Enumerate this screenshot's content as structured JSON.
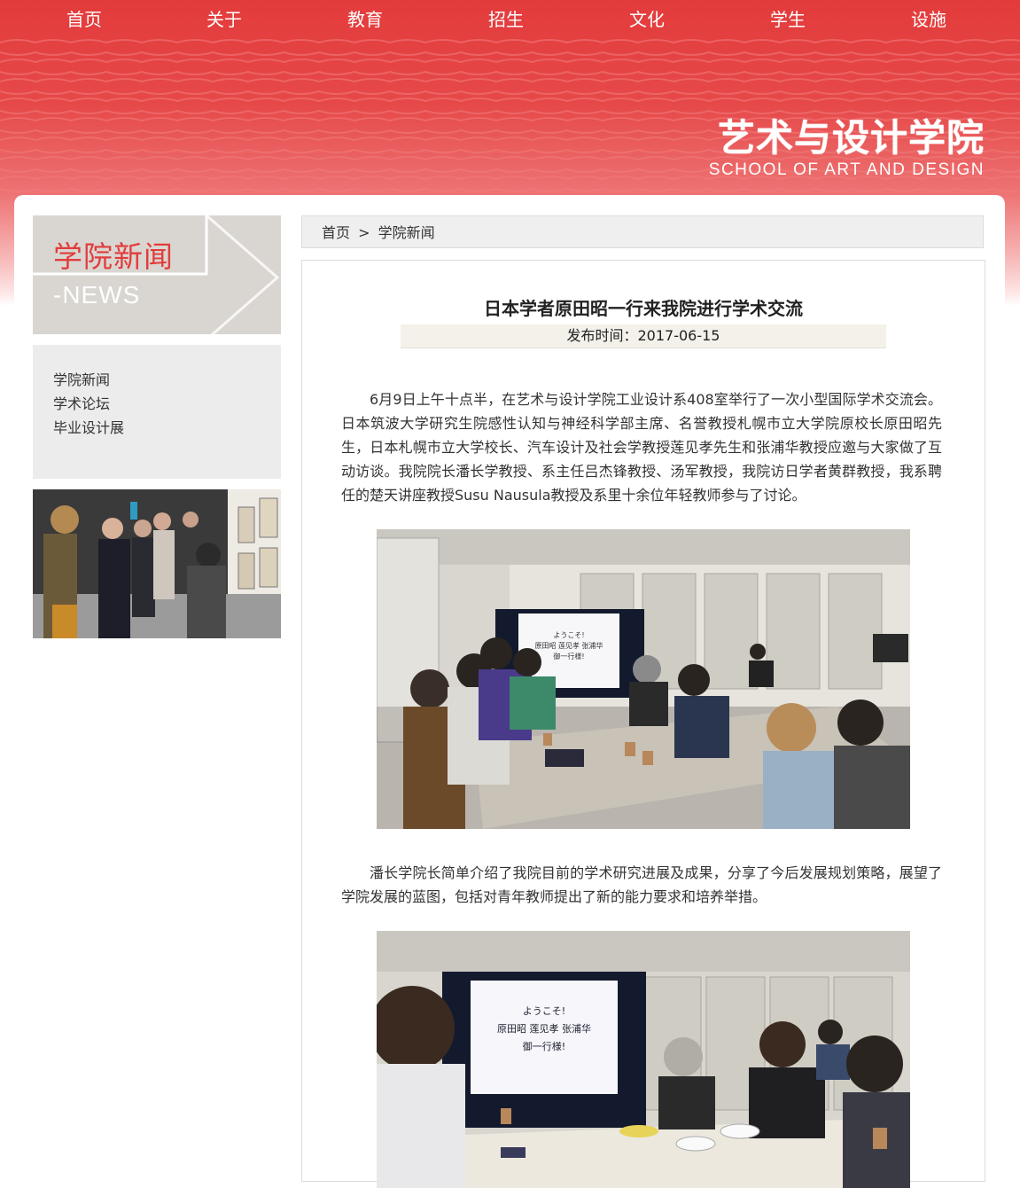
{
  "nav": [
    "首页",
    "关于",
    "教育",
    "招生",
    "文化",
    "学生",
    "设施"
  ],
  "logo": {
    "cn": "艺术与设计学院",
    "en": "SCHOOL OF ART AND DESIGN"
  },
  "sidebar": {
    "title": "学院新闻",
    "subtitle": "-NEWS",
    "links": [
      "学院新闻",
      "学术论坛",
      "毕业设计展"
    ]
  },
  "breadcrumb": {
    "home": "首页",
    "sep": ">",
    "current": "学院新闻"
  },
  "article": {
    "title": "日本学者原田昭一行来我院进行学术交流",
    "date": "发布时间：2017-06-15",
    "para1": "6月9日上午十点半，在艺术与设计学院工业设计系408室举行了一次小型国际学术交流会。日本筑波大学研究生院感性认知与神经科学部主席、名誉教授札幌市立大学院原校长原田昭先生，日本札幌市立大学校长、汽车设计及社会学教授莲见孝先生和张浦华教授应邀与大家做了互动访谈。我院院长潘长学教授、系主任吕杰锋教授、汤军教授，我院访日学者黄群教授，我系聘任的楚天讲座教授Susu Nausula教授及系里十余位年轻教师参与了讨论。",
    "para2": "潘长学院长简单介绍了我院目前的学术研究进展及成果，分享了今后发展规划策略，展望了学院发展的蓝图，包括对青年教师提出了新的能力要求和培养举措。",
    "screen1": [
      "ようこそ!",
      "原田昭 莲见孝 张浦华",
      "御一行様!"
    ],
    "screen2": [
      "ようこそ!",
      "原田昭 莲见孝 张浦华",
      "御一行様!"
    ]
  },
  "colors": {
    "brand_red": "#e23c3c",
    "banner_red": "#e6494a"
  }
}
